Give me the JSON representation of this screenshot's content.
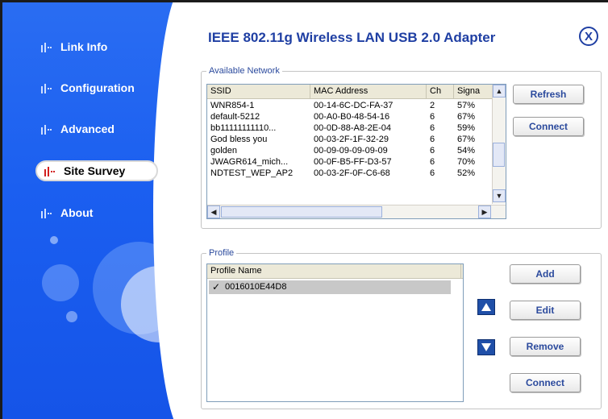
{
  "app": {
    "title": "IEEE 802.11g Wireless LAN USB 2.0 Adapter",
    "close_label": "X"
  },
  "sidebar": {
    "items": [
      {
        "label": "Link Info"
      },
      {
        "label": "Configuration"
      },
      {
        "label": "Advanced"
      },
      {
        "label": "Site Survey",
        "active": true
      },
      {
        "label": "About"
      }
    ]
  },
  "available_network": {
    "legend": "Available Network",
    "columns": [
      "SSID",
      "MAC Address",
      "Ch",
      "Signa"
    ],
    "rows": [
      [
        "WNR854-1",
        "00-14-6C-DC-FA-37",
        "2",
        "57%"
      ],
      [
        "default-5212",
        "00-A0-B0-48-54-16",
        "6",
        "67%"
      ],
      [
        "bb11111111110...",
        "00-0D-88-A8-2E-04",
        "6",
        "59%"
      ],
      [
        "God bless you",
        "00-03-2F-1F-32-29",
        "6",
        "67%"
      ],
      [
        "golden",
        "00-09-09-09-09-09",
        "6",
        "54%"
      ],
      [
        "JWAGR614_mich...",
        "00-0F-B5-FF-D3-57",
        "6",
        "70%"
      ],
      [
        "NDTEST_WEP_AP2",
        "00-03-2F-0F-C6-68",
        "6",
        "52%"
      ]
    ],
    "buttons": {
      "refresh": "Refresh",
      "connect": "Connect"
    }
  },
  "profile": {
    "legend": "Profile",
    "column": "Profile Name",
    "rows": [
      "0016010E44D8"
    ],
    "buttons": {
      "add": "Add",
      "edit": "Edit",
      "remove": "Remove",
      "connect": "Connect"
    }
  },
  "colors": {
    "sidebar": "#1b5ff0",
    "title": "#1f3fa3",
    "button_text": "#2b4a9d"
  }
}
